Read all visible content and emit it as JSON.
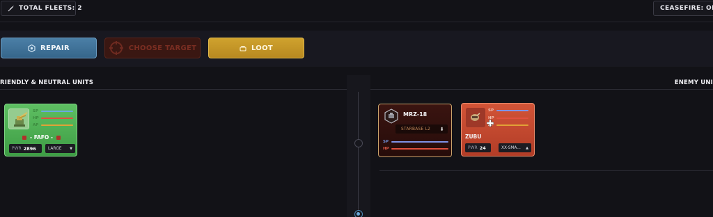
{
  "top_bar": {
    "fleets_label": "TOTAL FLEETS: 2",
    "ceasefire_label": "CEASEFIRE: OFF"
  },
  "actions": {
    "repair_label": "REPAIR",
    "choose_target_label": "CHOOSE TARGET",
    "loot_label": "LOOT"
  },
  "sections": {
    "friendly_title": "RIENDLY & NEUTRAL UNITS",
    "enemy_title": "ENEMY UNI"
  },
  "friendly_units": [
    {
      "name": "- FAFO -",
      "bar_labels": {
        "sp": "SP",
        "hp": "HP",
        "ap": "AP"
      },
      "pwr_label": "PWR",
      "pwr_value": "2896",
      "size": "LARGE",
      "portrait_icon": "turret-icon"
    }
  ],
  "enemy_units": [
    {
      "name": "MRZ-18",
      "subtype": "STARBASE L2",
      "bar_labels": {
        "sp": "SP",
        "hp": "HP"
      },
      "portrait_icon": "starbase-icon"
    },
    {
      "name": "ZUBU",
      "bar_labels": {
        "sp": "SP",
        "hp": "HP",
        "ap": "AP"
      },
      "pwr_label": "PWR",
      "pwr_value": "24",
      "size": "XX-SMA...",
      "portrait_icon": "ship-icon"
    }
  ],
  "colors": {
    "friendly_card": "#4caf50",
    "enemy_card": "#c8482f",
    "starbase_card": "#2e0f0c",
    "repair": "#4479a0",
    "loot": "#c5972a",
    "sp_bar": "#7e93e8",
    "hp_bar": "#e0503e",
    "ap_bar": "#e1a237"
  }
}
